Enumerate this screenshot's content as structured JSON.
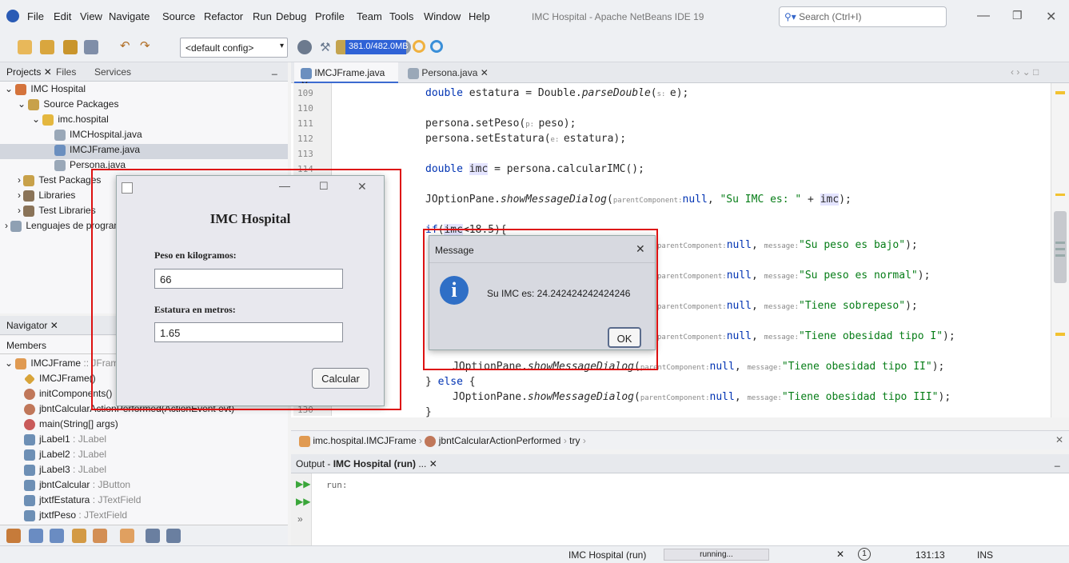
{
  "menubar": {
    "items": [
      "File",
      "Edit",
      "View",
      "Navigate",
      "Source",
      "Refactor",
      "Run",
      "Debug",
      "Profile",
      "Team",
      "Tools",
      "Window",
      "Help"
    ],
    "window_title": "IMC Hospital - Apache NetBeans IDE 19",
    "search_placeholder": "Search (Ctrl+I)"
  },
  "toolbar": {
    "config": "<default config>",
    "memory": "381.0/482.0MB"
  },
  "left": {
    "tabs": [
      "Projects",
      "Files",
      "Services"
    ],
    "tree": [
      {
        "label": "IMC Hospital",
        "indent": 0
      },
      {
        "label": "Source Packages",
        "indent": 1
      },
      {
        "label": "imc.hospital",
        "indent": 2
      },
      {
        "label": "IMCHospital.java",
        "indent": 3
      },
      {
        "label": "IMCJFrame.java",
        "indent": 3,
        "selected": true
      },
      {
        "label": "Persona.java",
        "indent": 3
      },
      {
        "label": "Test Packages",
        "indent": 1
      },
      {
        "label": "Libraries",
        "indent": 1
      },
      {
        "label": "Test Libraries",
        "indent": 1
      },
      {
        "label": "Lenguajes de programación",
        "indent": 0
      }
    ]
  },
  "navigator": {
    "tab": "Navigator",
    "members_label": "Members",
    "items": [
      {
        "name": "IMCJFrame",
        "type": " :: JFrame"
      },
      {
        "name": "IMCJFrame()",
        "type": ""
      },
      {
        "name": "initComponents()",
        "type": ""
      },
      {
        "name": "jbntCalcularActionPerformed(ActionEvent evt)",
        "type": ""
      },
      {
        "name": "main(String[] args)",
        "type": ""
      },
      {
        "name": "jLabel1",
        "type": " : JLabel"
      },
      {
        "name": "jLabel2",
        "type": " : JLabel"
      },
      {
        "name": "jLabel3",
        "type": " : JLabel"
      },
      {
        "name": "jbntCalcular",
        "type": " : JButton"
      },
      {
        "name": "jtxtfEstatura",
        "type": " : JTextField"
      },
      {
        "name": "jtxtfPeso",
        "type": " : JTextField"
      }
    ]
  },
  "editor": {
    "tabs": [
      "IMCJFrame.java",
      "Persona.java"
    ],
    "line_numbers": [
      "109",
      "110",
      "111",
      "112",
      "113",
      "114",
      "130"
    ],
    "breadcrumb": [
      "imc.hospital.IMCJFrame",
      "jbntCalcularActionPerformed",
      "try"
    ]
  },
  "imc_window": {
    "title": "IMC Hospital",
    "peso_label": "Peso en kilogramos:",
    "peso_value": "66",
    "estatura_label": "Estatura en metros:",
    "estatura_value": "1.65",
    "button": "Calcular"
  },
  "message_dialog": {
    "title": "Message",
    "text": "Su IMC es: 24.242424242424246",
    "button": "OK"
  },
  "output": {
    "tab_prefix": "Output - ",
    "tab_bold": "IMC Hospital (run)",
    "tab_suffix": " ...",
    "line": "run:"
  },
  "status": {
    "task": "IMC Hospital (run)",
    "state": "running...",
    "notifications": "1",
    "position": "131:13",
    "mode": "INS"
  }
}
